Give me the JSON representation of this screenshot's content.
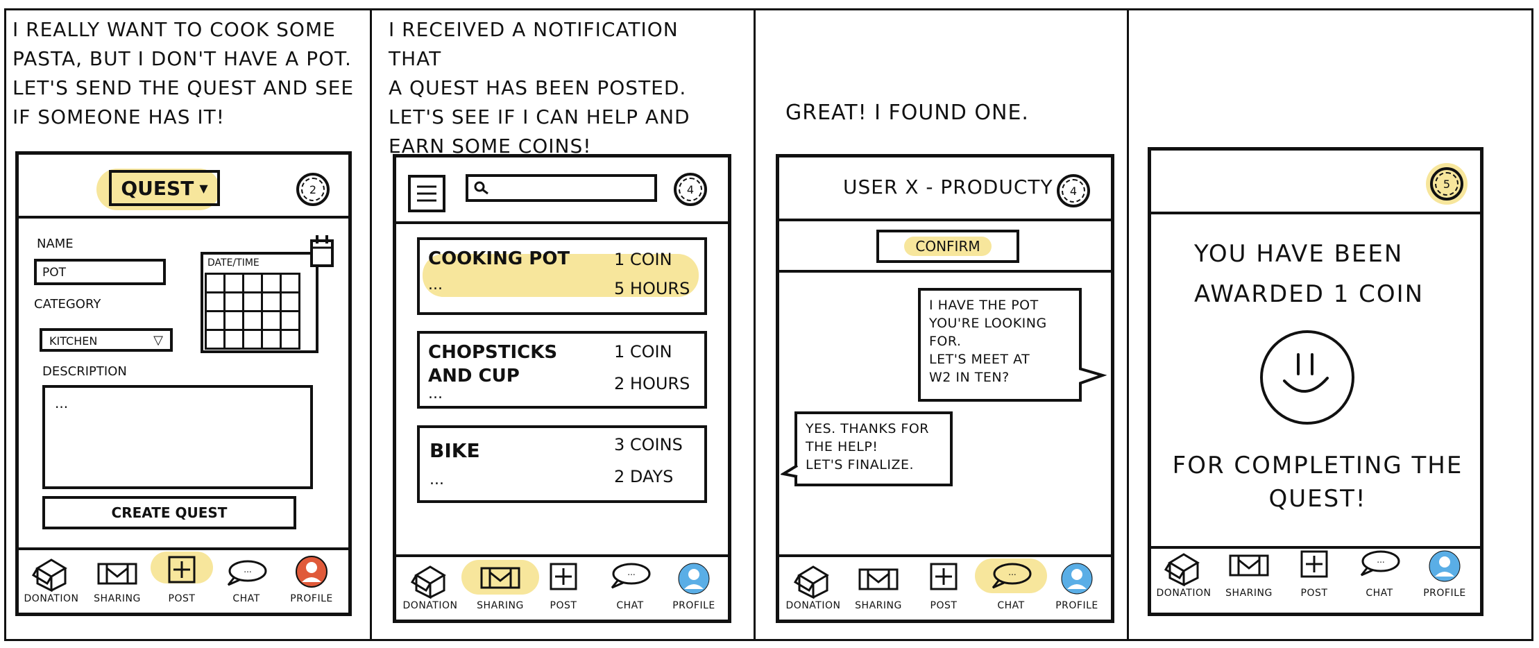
{
  "colors": {
    "highlight": "#f7e69c",
    "profile_red": "#e05a3a",
    "profile_blue": "#5aaee6",
    "ink": "#111111"
  },
  "panel1": {
    "caption": "I really want to cook some\npasta, but I don't have a pot.\nLet's send the quest and see\nif someone has it!",
    "header_title": "QUEST",
    "coin_count": "2",
    "name_label": "NAME",
    "name_value": "POT",
    "datetime_label": "DATE/TIME",
    "category_label": "CATEGORY",
    "category_value": "KITCHEN",
    "description_label": "DESCRIPTION",
    "description_value": "...",
    "create_button": "CREATE QUEST",
    "nav": {
      "donation": "DONATION",
      "sharing": "SHARING",
      "post": "POST",
      "chat": "CHAT",
      "profile": "PROFILE"
    }
  },
  "panel2": {
    "caption": "I received a notification that\na quest has been posted.\nLet's see if I can help and\nearn some coins!",
    "coin_count": "4",
    "search_icon": "search-icon",
    "items": [
      {
        "title": "COOKING POT",
        "reward": "1 COIN",
        "dots": "...",
        "time": "5 HOURS"
      },
      {
        "title": "CHOPSTICKS AND CUP",
        "reward": "1 COIN",
        "dots": "...",
        "time": "2 HOURS"
      },
      {
        "title": "BIKE",
        "reward": "3 COINS",
        "dots": "...",
        "time": "2 DAYS"
      }
    ],
    "nav": {
      "donation": "DONATION",
      "sharing": "SHARING",
      "post": "POST",
      "chat": "CHAT",
      "profile": "PROFILE"
    }
  },
  "panel3": {
    "caption": "Great! I found one.",
    "header_title": "USER X - PRODUCTY",
    "coin_count": "4",
    "confirm_button": "CONFIRM",
    "message_out": "I have the pot\nyou're looking\nfor.\nLet's meet at\nW2 in ten?",
    "message_in": "Yes. Thanks for\nthe help!\nLet's finalize.",
    "nav": {
      "donation": "DONATION",
      "sharing": "SHARING",
      "post": "POST",
      "chat": "CHAT",
      "profile": "PROFILE"
    }
  },
  "panel4": {
    "coin_count": "5",
    "award_text": "YOU HAVE BEEN\nAWARDED 1 COIN",
    "award_text2": "FOR COMPLETING THE\nQUEST!",
    "nav": {
      "donation": "DONATION",
      "sharing": "SHARING",
      "post": "POST",
      "chat": "CHAT",
      "profile": "PROFILE"
    }
  }
}
